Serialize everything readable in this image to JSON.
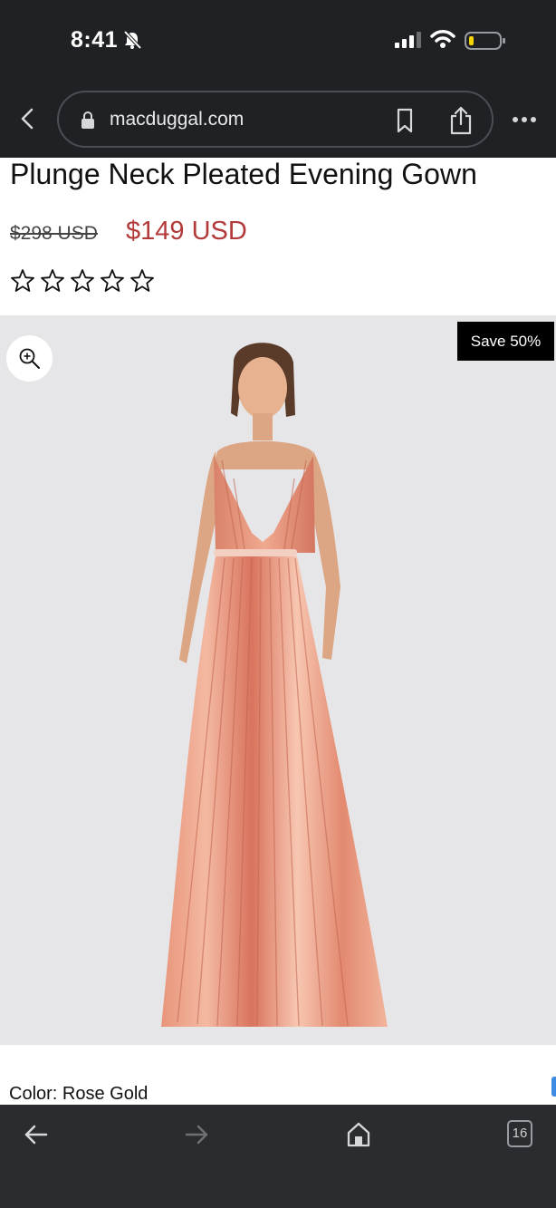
{
  "status_bar": {
    "time": "8:41",
    "silent_icon": "bell-slash-icon",
    "signal_icon": "cellular-signal-icon",
    "wifi_icon": "wifi-icon",
    "battery_icon": "battery-low-icon",
    "battery_color": "#f5d300"
  },
  "browser": {
    "url": "macduggal.com",
    "back_icon": "chevron-left-icon",
    "lock_icon": "lock-icon",
    "bookmark_icon": "bookmark-icon",
    "share_icon": "share-icon",
    "more_icon": "ellipsis-icon"
  },
  "product": {
    "title": "Plunge Neck Pleated Evening Gown",
    "original_price": "$298 USD",
    "sale_price": "$149 USD",
    "sale_price_color": "#b33a3a",
    "rating_stars_total": 5,
    "rating_stars_filled": 0,
    "save_badge": "Save 50%",
    "zoom_icon": "zoom-in-icon",
    "image_subject": "rose-gold pleated gown",
    "color_label": "Color: Rose Gold"
  },
  "toolbar": {
    "back_icon": "arrow-left-icon",
    "forward_icon": "arrow-right-icon",
    "home_icon": "home-icon",
    "tab_count": "16"
  }
}
